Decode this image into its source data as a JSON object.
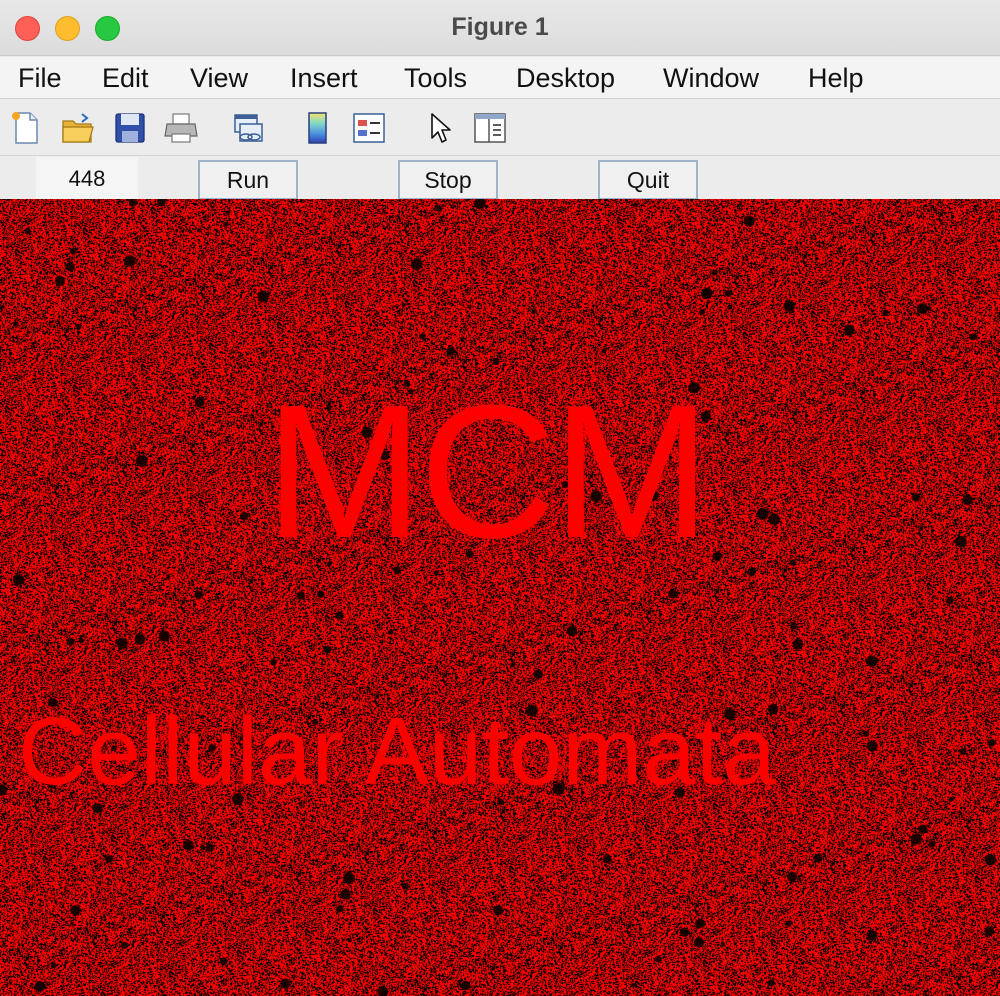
{
  "window": {
    "title": "Figure 1"
  },
  "menubar": {
    "items": [
      {
        "label": "File"
      },
      {
        "label": "Edit"
      },
      {
        "label": "View"
      },
      {
        "label": "Insert"
      },
      {
        "label": "Tools"
      },
      {
        "label": "Desktop"
      },
      {
        "label": "Window"
      },
      {
        "label": "Help"
      }
    ]
  },
  "toolbar": {
    "icons": [
      "new-figure-icon",
      "open-file-icon",
      "save-icon",
      "print-icon",
      "link-plot-icon",
      "colorbar-icon",
      "legend-icon",
      "pointer-icon",
      "property-editor-icon"
    ]
  },
  "controls": {
    "counter_value": "448",
    "run_label": "Run",
    "stop_label": "Stop",
    "quit_label": "Quit"
  },
  "canvas": {
    "title_text": "MCM",
    "subtitle_text": "Cellular Automata",
    "colors": {
      "live": "#ff0000",
      "dead": "#000000",
      "text": "#ff0000"
    }
  }
}
